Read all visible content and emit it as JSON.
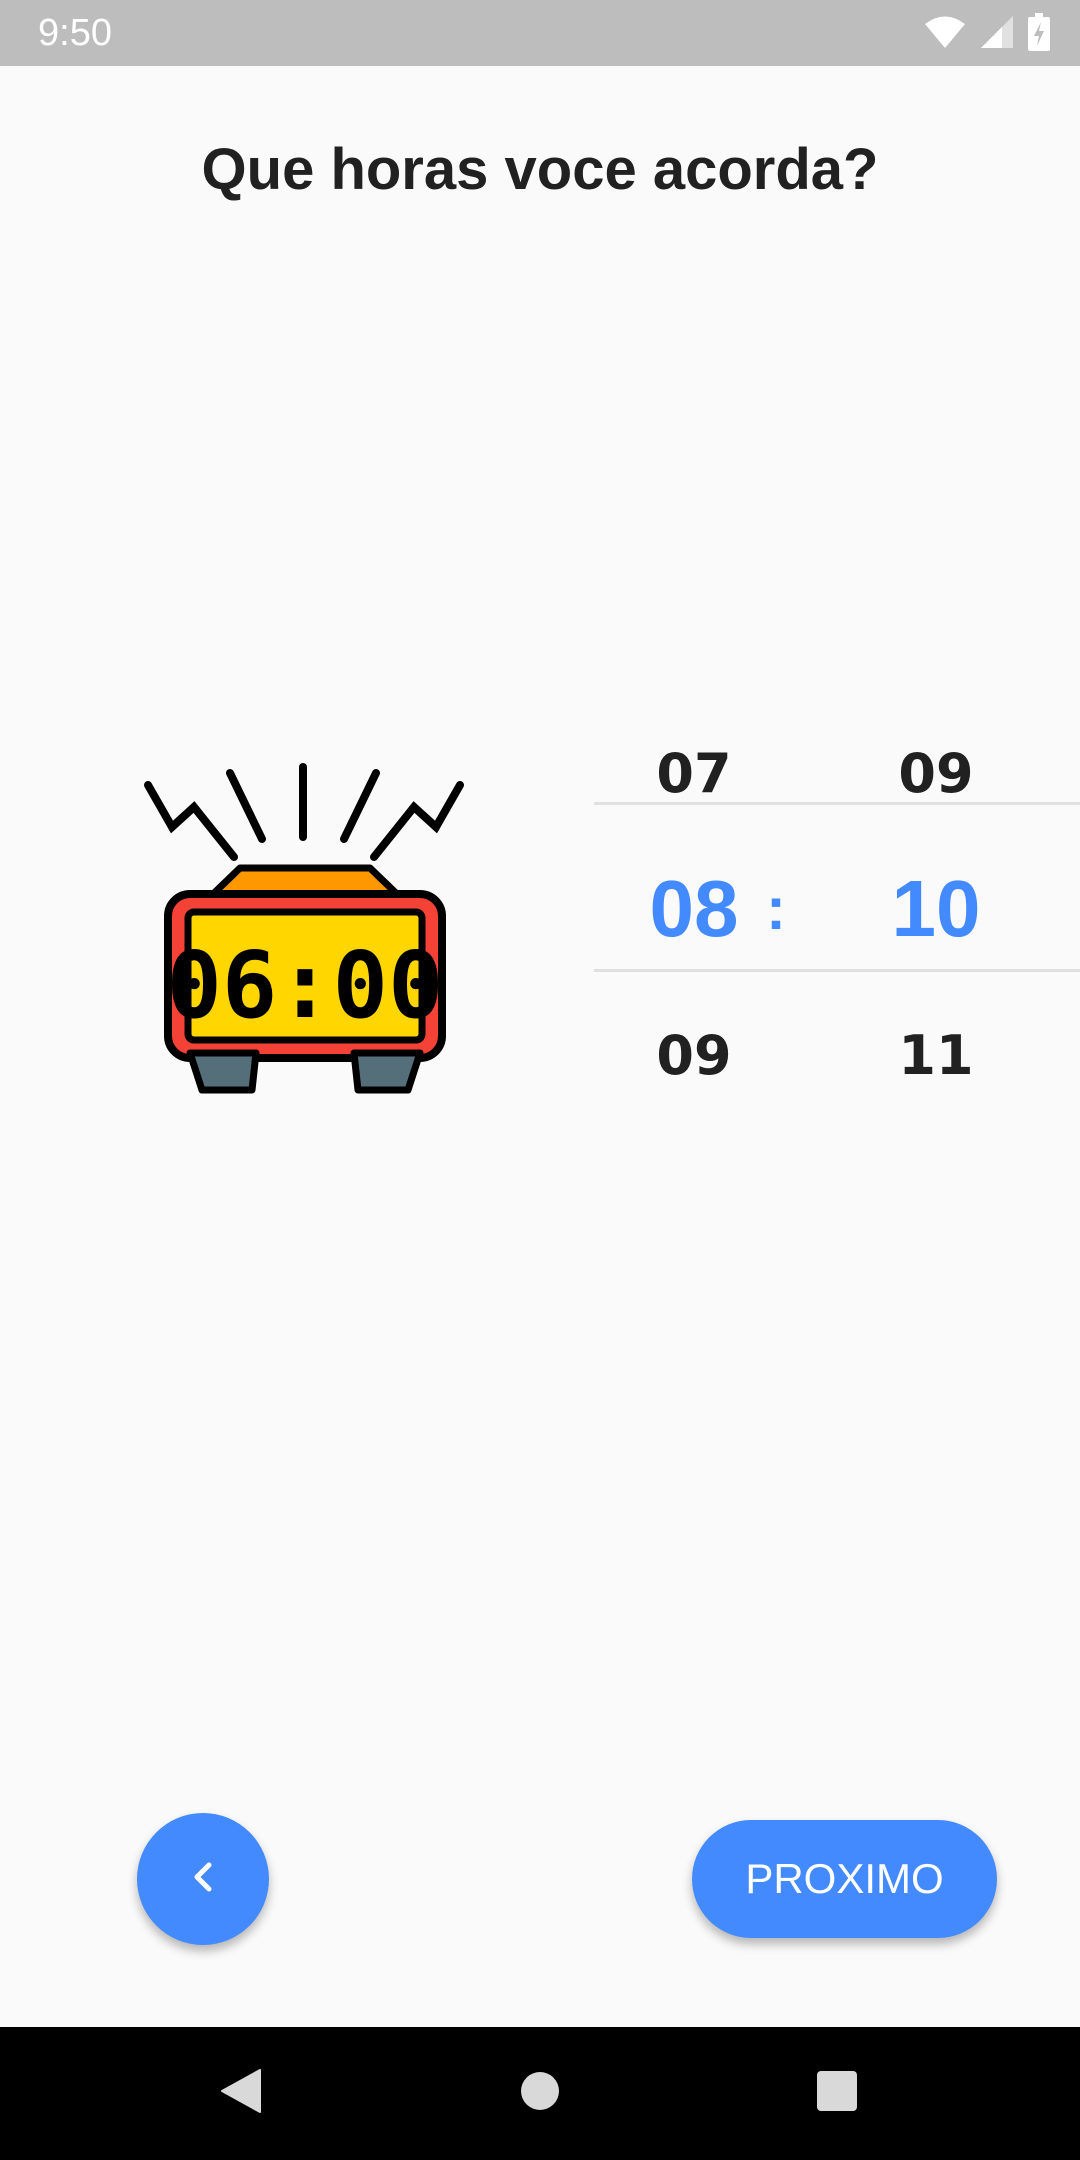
{
  "status_bar": {
    "time": "9:50",
    "icons": [
      "wifi-icon",
      "cell-signal-icon",
      "battery-charging-icon"
    ]
  },
  "screen": {
    "title": "Que horas voce acorda?"
  },
  "illustration": {
    "icon": "alarm-clock-icon",
    "display_time": "06:00"
  },
  "time_picker": {
    "separator": ":",
    "accent_color": "#448AFF",
    "hours": {
      "above": "07",
      "selected": "08",
      "below": "09"
    },
    "minutes": {
      "above": "09",
      "selected": "10",
      "below": "11"
    }
  },
  "actions": {
    "back_icon": "chevron-left-icon",
    "next_label": "PROXIMO"
  },
  "nav_bar": {
    "icons": [
      "back-triangle-icon",
      "home-circle-icon",
      "recents-square-icon"
    ]
  }
}
